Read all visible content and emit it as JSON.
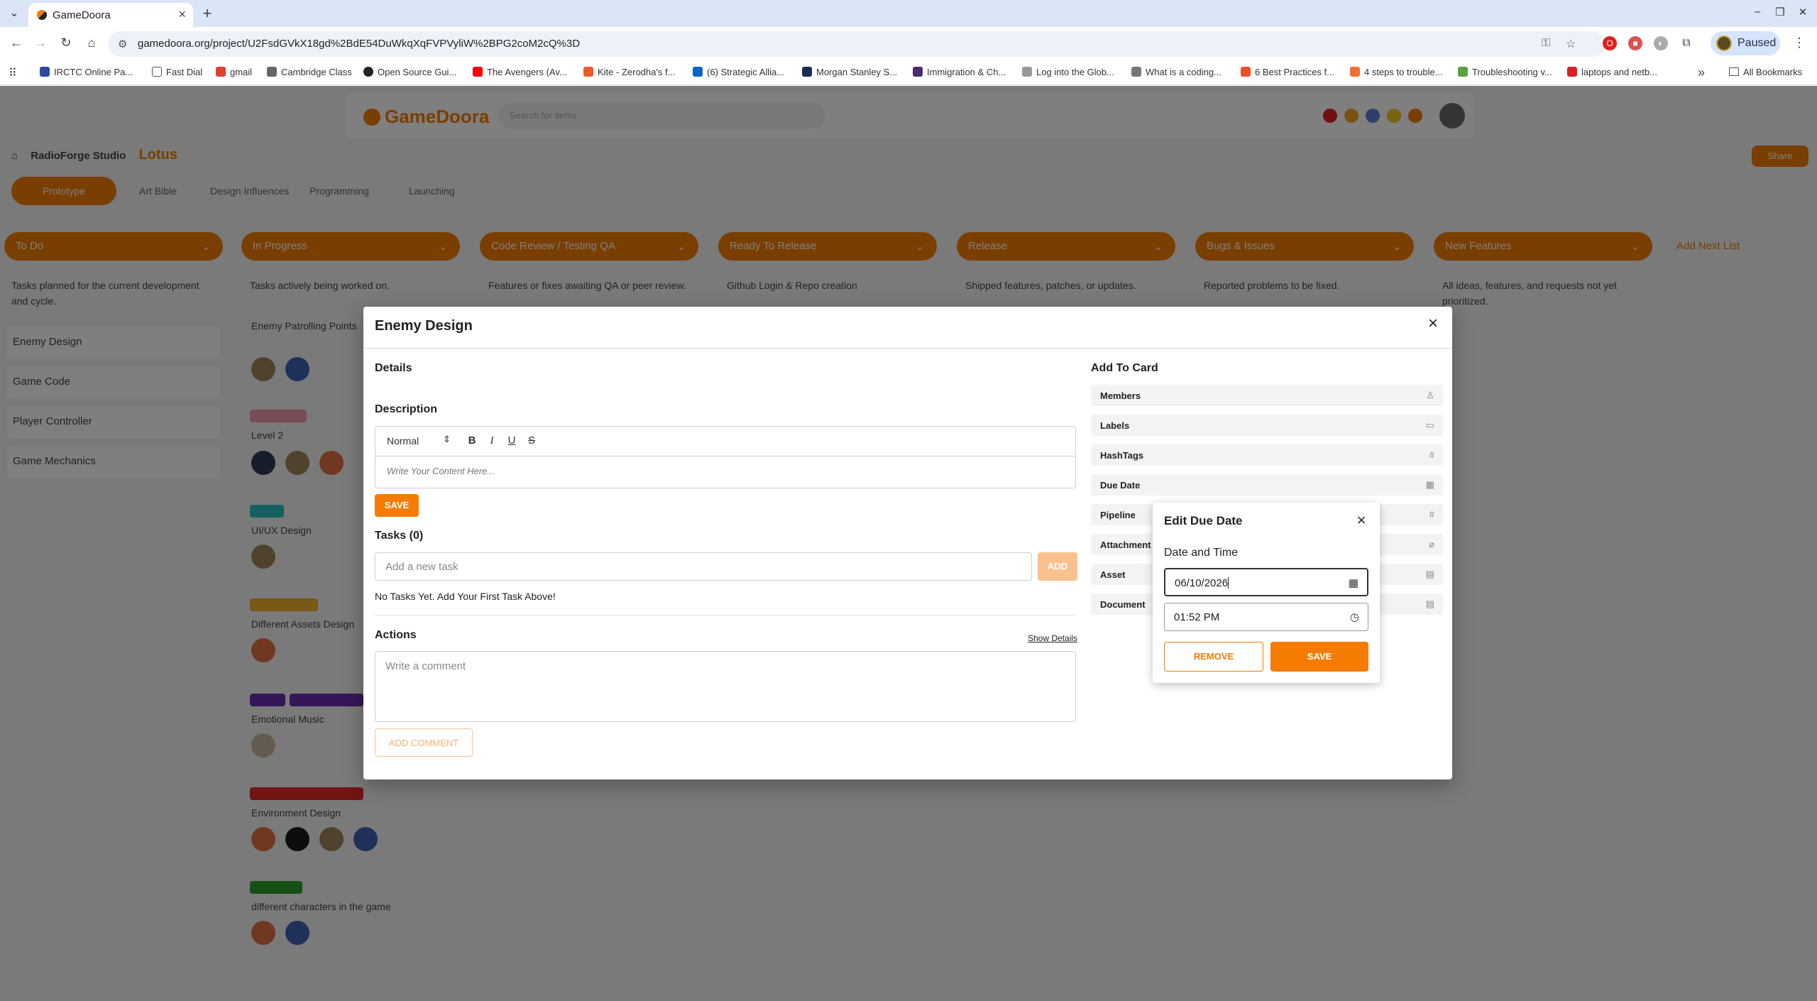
{
  "browser": {
    "tab_title": "GameDoora",
    "url": "gamedoora.org/project/U2FsdGVkX18gd%2BdE54DuWkqXqFVPVyliW%2BPG2coM2cQ%3D",
    "profile_label": "Paused",
    "bookmarks": [
      "IRCTC Online Pa...",
      "Fast Dial",
      "gmail",
      "Cambridge Class",
      "Open Source Gui...",
      "The Avengers (Av...",
      "Kite - Zerodha's f...",
      "(6) Strategic Allia...",
      "Morgan Stanley S...",
      "Immigration & Ch...",
      "Log into the Glob...",
      "What is a coding...",
      "6 Best Practices f...",
      "4 steps to trouble...",
      "Troubleshooting v...",
      "laptops and netb..."
    ],
    "all_bookmarks": "All Bookmarks"
  },
  "app": {
    "logo": "GameDoora",
    "search_placeholder": "Search for items",
    "breadcrumb": {
      "studio": "RadioForge Studio",
      "project": "Lotus"
    },
    "share_label": "Share",
    "tabs": [
      "Prototype",
      "Art Bible",
      "Design Influences",
      "Programming",
      "Launching"
    ],
    "columns": [
      {
        "title": "To Do",
        "desc": "Tasks planned for the current development and cycle."
      },
      {
        "title": "In Progress",
        "desc": "Tasks actively being worked on."
      },
      {
        "title": "Code Review / Testing QA",
        "desc": "Features or fixes awaiting QA or peer review."
      },
      {
        "title": "Ready To Release",
        "desc": "Github Login & Repo creation"
      },
      {
        "title": "Release",
        "desc": "Shipped features, patches, or updates."
      },
      {
        "title": "Bugs & Issues",
        "desc": "Reported problems to be fixed."
      },
      {
        "title": "New Features",
        "desc": "All ideas, features, and requests not yet prioritized."
      }
    ],
    "add_list": "Add Next List",
    "todo_cards": [
      "Enemy Design",
      "Game Code",
      "Player Controller",
      "Game Mechanics"
    ],
    "progress_cards": [
      "Enemy Patrolling Points",
      "Level 2",
      "UI/UX Design",
      "Different Assets Design",
      "Emotional Music",
      "Environment Design",
      "different characters in the game"
    ]
  },
  "modal": {
    "title": "Enemy Design",
    "details_heading": "Details",
    "description_heading": "Description",
    "format_select": "Normal",
    "editor_placeholder": "Write Your Content Here...",
    "save_label": "SAVE",
    "tasks_heading": "Tasks (0)",
    "task_placeholder": "Add a new task",
    "add_label": "ADD",
    "no_tasks": "No Tasks Yet. Add Your First Task Above!",
    "actions_heading": "Actions",
    "show_details": "Show Details",
    "comment_placeholder": "Write a comment",
    "add_comment": "ADD COMMENT",
    "add_to_card_heading": "Add To Card",
    "add_to_card": [
      "Members",
      "Labels",
      "HashTags",
      "Due Date",
      "Pipeline",
      "Attachment",
      "Asset",
      "Document"
    ]
  },
  "due_date": {
    "title": "Edit Due Date",
    "label": "Date and Time",
    "date_value": "06/10/2026",
    "time_value": "01:52 PM",
    "remove_label": "REMOVE",
    "save_label": "SAVE"
  },
  "colors": {
    "accent": "#f57c00",
    "accent_light": "#fbc08e"
  }
}
